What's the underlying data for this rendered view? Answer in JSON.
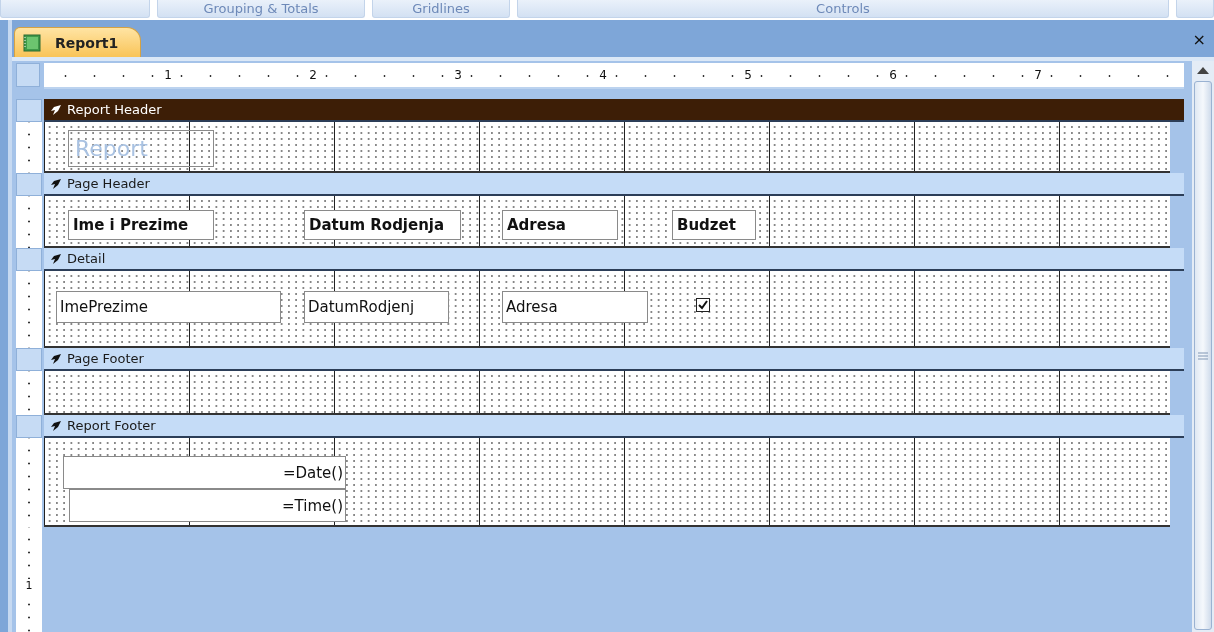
{
  "ribbon_groups": [
    "Grouping & Totals",
    "Gridlines",
    "Controls"
  ],
  "document_tab": {
    "label": "Report1",
    "selected": true
  },
  "close_button": "×",
  "horizontal_ruler": {
    "labels": [
      "1",
      "2",
      "3",
      "4",
      "5",
      "6",
      "7"
    ]
  },
  "vertical_ruler": {
    "labels": [
      "1"
    ]
  },
  "sections": [
    {
      "title": "Report Header",
      "selected": true,
      "controls": [
        {
          "kind": "title",
          "text": "Report"
        }
      ]
    },
    {
      "title": "Page Header",
      "selected": false,
      "controls": [
        {
          "kind": "label",
          "text": "Ime i Prezime"
        },
        {
          "kind": "label",
          "text": "Datum Rodjenja"
        },
        {
          "kind": "label",
          "text": "Adresa"
        },
        {
          "kind": "label",
          "text": "Budzet"
        }
      ]
    },
    {
      "title": "Detail",
      "selected": false,
      "controls": [
        {
          "kind": "textbox",
          "text": "ImePrezime"
        },
        {
          "kind": "textbox",
          "text": "DatumRodjenj"
        },
        {
          "kind": "textbox",
          "text": "Adresa"
        },
        {
          "kind": "checkbox",
          "checked": true
        }
      ]
    },
    {
      "title": "Page Footer",
      "selected": false
    },
    {
      "title": "Report Footer",
      "selected": false,
      "controls": [
        {
          "kind": "expression",
          "text": "=Date()"
        },
        {
          "kind": "expression",
          "text": "=Time()"
        }
      ]
    }
  ]
}
